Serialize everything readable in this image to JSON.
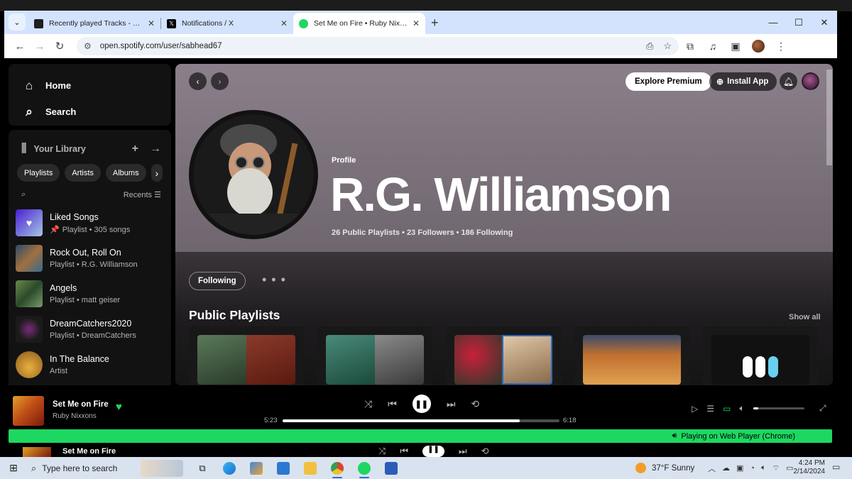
{
  "browser": {
    "tabs": [
      {
        "title": "Recently played Tracks - Stats fo",
        "favicon_color": "#1f1f1f",
        "active": false
      },
      {
        "title": "Notifications / X",
        "favicon_color": "#000000",
        "active": false
      },
      {
        "title": "Set Me on Fire • Ruby Nixxons",
        "favicon_color": "#1ed760",
        "active": true
      }
    ],
    "new_tab": "+",
    "url": "open.spotify.com/user/sabhead67"
  },
  "sidebar": {
    "nav": [
      {
        "label": "Home",
        "icon": "home-icon"
      },
      {
        "label": "Search",
        "icon": "search-icon"
      }
    ],
    "library_title": "Your Library",
    "chips": [
      "Playlists",
      "Artists",
      "Albums"
    ],
    "sort_label": "Recents",
    "items": [
      {
        "name": "Liked Songs",
        "subtitle": "Playlist • 305 songs",
        "pinned": true,
        "color": "#5f3bd6"
      },
      {
        "name": "Rock Out, Roll On",
        "subtitle": "Playlist • R.G. Williamson",
        "pinned": false,
        "color": "#3a6a8c"
      },
      {
        "name": "Angels",
        "subtitle": "Playlist • matt geiser",
        "pinned": false,
        "color": "#4e7a3a"
      },
      {
        "name": "DreamCatchers2020",
        "subtitle": "Playlist • DreamCatchers",
        "pinned": false,
        "color": "#2a2a2a"
      },
      {
        "name": "In The Balance",
        "subtitle": "Artist",
        "pinned": false,
        "color": "#d6a02a"
      }
    ]
  },
  "header": {
    "explore_premium": "Explore Premium",
    "install_app": "Install App"
  },
  "profile": {
    "label": "Profile",
    "name": "R.G. Williamson",
    "stats": "26 Public Playlists • 23 Followers • 186 Following",
    "follow_button": "Following",
    "more": "• • •"
  },
  "playlists_section": {
    "title": "Public Playlists",
    "show_all": "Show all",
    "covers": [
      {
        "left": "#3a5a3a",
        "right": "#7a2a1a"
      },
      {
        "left": "#3a7a6a",
        "right": "#5a5a5a"
      },
      {
        "left": "#8a1a2a",
        "right": "#c8a070"
      },
      {
        "left": "#c07030",
        "right": "#c07030"
      },
      {
        "left": "#111111",
        "right": "#111111"
      }
    ]
  },
  "player": {
    "title": "Set Me on Fire",
    "artist": "Ruby Nixxons",
    "elapsed": "5:23",
    "duration": "6:18",
    "progress": 0.856,
    "volume": 0.1,
    "device_banner": "Playing on Web Player (Chrome)"
  },
  "taskbar": {
    "search_placeholder": "Type here to search",
    "weather": "37°F  Sunny",
    "time": "4:24 PM",
    "date": "2/14/2024"
  }
}
